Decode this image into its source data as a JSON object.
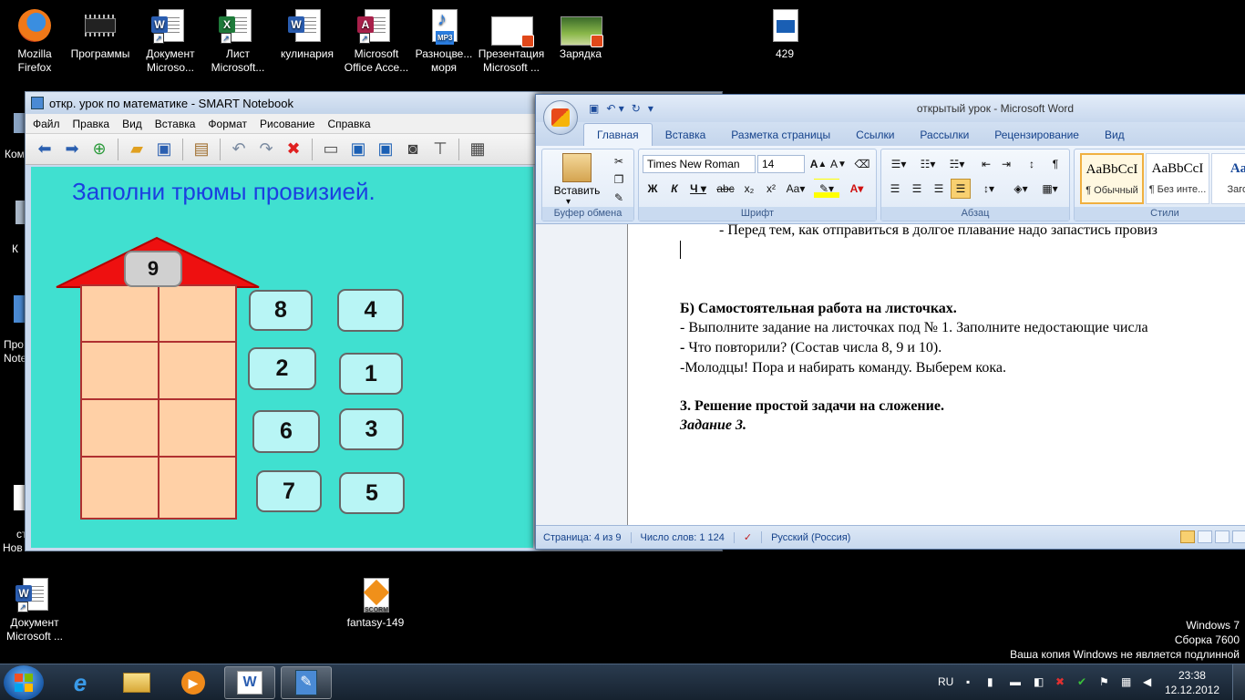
{
  "desktop": {
    "icons": [
      {
        "id": "firefox",
        "label": "Mozilla\nFirefox"
      },
      {
        "id": "programs",
        "label": "Программы"
      },
      {
        "id": "doc1",
        "label": "Документ\nMicroso..."
      },
      {
        "id": "sheet",
        "label": "Лист\nMicrosoft..."
      },
      {
        "id": "kulinaria",
        "label": "кулинария"
      },
      {
        "id": "access",
        "label": "Microsoft\nOffice Acce..."
      },
      {
        "id": "mp3",
        "label": "Разноцве...\nморя"
      },
      {
        "id": "pres",
        "label": "Презентация\nMicrosoft ..."
      },
      {
        "id": "zaryadka",
        "label": "Зарядка"
      },
      {
        "id": "file429",
        "label": "429"
      },
      {
        "id": "doc2",
        "label": "Документ\nMicrosoft ..."
      },
      {
        "id": "scorm",
        "label": "fantasy-149"
      }
    ],
    "partial_labels": {
      "kom": "Ком",
      "k": "К",
      "pro": "Про",
      "note": "Note",
      "st": "ст",
      "nov": "Нов"
    }
  },
  "notebook": {
    "title": "откр. урок по математике - SMART Notebook",
    "menu": [
      "Файл",
      "Правка",
      "Вид",
      "Вставка",
      "Формат",
      "Рисование",
      "Справка"
    ],
    "task": "Заполни трюмы провизией.",
    "roof_number": "9",
    "cards": [
      "8",
      "4",
      "2",
      "1",
      "6",
      "3",
      "7",
      "5"
    ]
  },
  "word": {
    "title": "открытый урок - Microsoft Word",
    "tabs": [
      "Главная",
      "Вставка",
      "Разметка страницы",
      "Ссылки",
      "Рассылки",
      "Рецензирование",
      "Вид"
    ],
    "font_name": "Times New Roman",
    "font_size": "14",
    "paste_label": "Вставить",
    "groups": {
      "clipboard": "Буфер обмена",
      "font": "Шрифт",
      "paragraph": "Абзац",
      "styles": "Стили"
    },
    "styles": [
      {
        "sample": "AaBbCcI",
        "name": "¶ Обычный"
      },
      {
        "sample": "AaBbCcI",
        "name": "¶ Без инте..."
      },
      {
        "sample": "AaB",
        "name": "Заголо"
      }
    ],
    "document": {
      "line_top": "- Перед тем, как отправиться в долгое плавание надо запастись провиз",
      "heading_b": "Б) Самостоятельная работа  на листочках.",
      "line1": "- Выполните задание на листочках под № 1. Заполните недостающие числа",
      "line2_dash": "-",
      "line2": " Что повторили? (Состав числа 8, 9 и 10).",
      "line3": "-Молодцы! Пора и набирать команду. Выберем кока.",
      "heading_3": "3. Решение простой задачи на сложение.",
      "task_3": "Задание  3."
    },
    "status": {
      "page": "Страница: 4 из 9",
      "words": "Число слов: 1 124",
      "lang": "Русский (Россия)"
    }
  },
  "watermark": [
    "Windows 7",
    "Сборка 7600",
    "Ваша копия Windows не является подлинной"
  ],
  "taskbar": {
    "lang": "RU",
    "time": "23:38",
    "date": "12.12.2012"
  }
}
